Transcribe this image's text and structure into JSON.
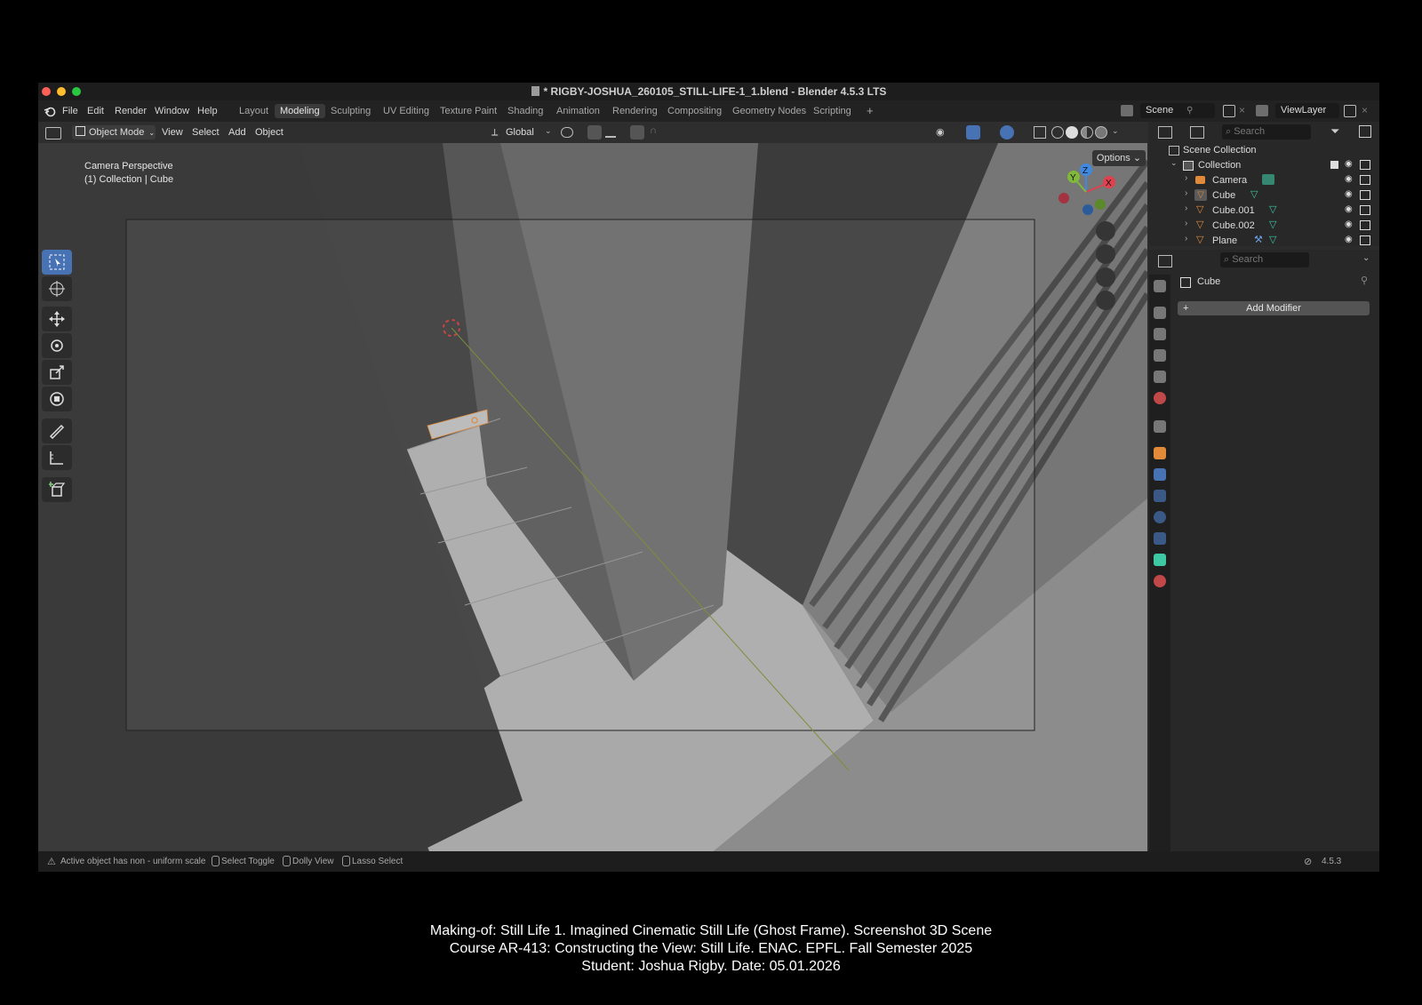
{
  "window": {
    "title": "* RIGBY-JOSHUA_260105_STILL-LIFE-1_1.blend - Blender 4.5.3 LTS"
  },
  "menu": [
    "File",
    "Edit",
    "Render",
    "Window",
    "Help"
  ],
  "workspaces": [
    "Layout",
    "Modeling",
    "Sculpting",
    "UV Editing",
    "Texture Paint",
    "Shading",
    "Animation",
    "Rendering",
    "Compositing",
    "Geometry Nodes",
    "Scripting"
  ],
  "active_workspace": "Modeling",
  "scene_field": "Scene",
  "viewlayer_field": "ViewLayer",
  "viewport_header": {
    "mode": "Object Mode",
    "menus": [
      "View",
      "Select",
      "Add",
      "Object"
    ],
    "orientation": "Global",
    "options_label": "Options"
  },
  "viewport": {
    "perspective": "Camera Perspective",
    "context": "(1) Collection | Cube",
    "gizmo_axes": [
      "Z",
      "Y",
      "X"
    ]
  },
  "outliner": {
    "search_placeholder": "Search",
    "scene_collection": "Scene Collection",
    "collection": "Collection",
    "items": [
      {
        "name": "Camera",
        "icon": "camera-icon"
      },
      {
        "name": "Cube",
        "icon": "mesh-icon"
      },
      {
        "name": "Cube.001",
        "icon": "mesh-icon"
      },
      {
        "name": "Cube.002",
        "icon": "mesh-icon"
      },
      {
        "name": "Plane",
        "icon": "mesh-icon"
      }
    ]
  },
  "properties": {
    "search_placeholder": "Search",
    "object_name": "Cube",
    "add_modifier": "Add Modifier"
  },
  "statusbar": {
    "warning": "Active object has non - uniform scale",
    "hint1": "Select Toggle",
    "hint2": "Dolly View",
    "hint3": "Lasso Select",
    "version": "4.5.3"
  },
  "caption": {
    "line1": "Making-of: Still Life 1. Imagined Cinematic Still Life (Ghost Frame). Screenshot 3D Scene",
    "line2": "Course AR-413: Constructing the View: Still Life. ENAC. EPFL. Fall Semester 2025",
    "line3": "Student: Joshua Rigby. Date: 05.01.2026"
  },
  "colors": {
    "active_blue": "#4772b3",
    "axis_x": "#e0414f",
    "axis_y": "#7fb83a",
    "axis_z": "#3f8ae0",
    "mesh_orange": "#e08a3a",
    "mesh_green": "#3ec7a3"
  }
}
